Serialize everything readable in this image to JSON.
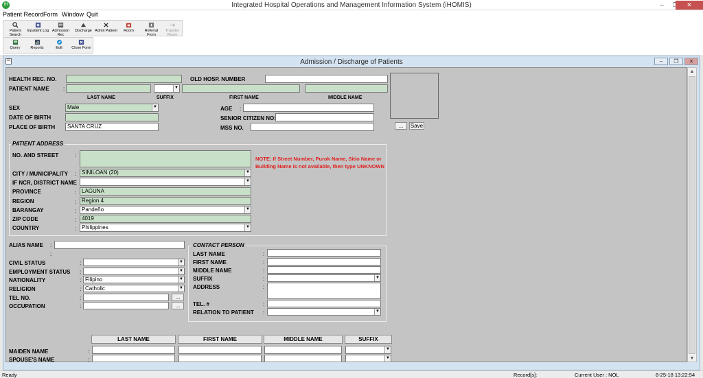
{
  "window": {
    "title": "Integrated Hospital Operations and Management Information System (iHOMIS)",
    "icon_text": "IH",
    "min": "–",
    "max": "❐",
    "close": "✕"
  },
  "menu": [
    "Patient Record",
    "Form",
    "Window",
    "Quit"
  ],
  "toolbar1": [
    {
      "label": "Patient Search",
      "icon": "patient-search-icon"
    },
    {
      "label": "Inpatient Log",
      "icon": "inpatient-log-icon"
    },
    {
      "label": "Admission Rec",
      "icon": "admission-record-icon"
    },
    {
      "label": "Discharge",
      "icon": "discharge-icon"
    },
    {
      "label": "Admit Patient",
      "icon": "admit-patient-icon"
    },
    {
      "label": "Room",
      "icon": "room-icon"
    },
    {
      "label": "Referral From",
      "icon": "referral-icon"
    },
    {
      "label": "Transfer Room",
      "icon": "transfer-room-icon"
    }
  ],
  "toolbar2": [
    {
      "label": "Query",
      "icon": "query-icon"
    },
    {
      "label": "Reports",
      "icon": "reports-icon"
    },
    {
      "label": "Edit",
      "icon": "edit-icon"
    },
    {
      "label": "Close Form",
      "icon": "close-form-icon"
    }
  ],
  "child": {
    "title": "Admission / Discharge of Patients"
  },
  "form": {
    "health_rec_no": {
      "label": "HEALTH REC. NO.",
      "value": ""
    },
    "old_hosp_number": {
      "label": "OLD HOSP. NUMBER",
      "value": ""
    },
    "patient_name": {
      "label": "PATIENT NAME",
      "colon": ":"
    },
    "name_headers": {
      "last": "LAST NAME",
      "suffix": "SUFFIX",
      "first": "FIRST NAME",
      "middle": "MIDDLE NAME"
    },
    "sex": {
      "label": "SEX",
      "value": "Male"
    },
    "date_of_birth": {
      "label": "DATE OF BIRTH",
      "value": ""
    },
    "place_of_birth": {
      "label": "PLACE OF BIRTH",
      "value": "SANTA CRUZ"
    },
    "age": {
      "label": "AGE",
      "value": ""
    },
    "senior_citizen_no": {
      "label": "SENIOR CITIZEN NO:",
      "value": ""
    },
    "mss_no": {
      "label": "MSS NO.",
      "value": ""
    },
    "photo": {
      "browse": "...",
      "save": "Save"
    },
    "address": {
      "title": "PATIENT ADDRESS",
      "no_and_street": {
        "label": "NO. AND STREET",
        "value": ""
      },
      "note": "NOTE:  If Street Number, Purok Name, Sitio Name or Building Name is not available, then type UNKNOWN",
      "city": {
        "label": "CITY / MUNICIPALITY",
        "value": "SINILOAN  (20)"
      },
      "ncr_district": {
        "label": "IF NCR, DISTRICT NAME",
        "value": ""
      },
      "province": {
        "label": "PROVINCE",
        "value": "LAGUNA"
      },
      "region": {
        "label": "REGION",
        "value": "Region 4"
      },
      "barangay": {
        "label": "BARANGAY",
        "value": "Pandeño"
      },
      "zip_code": {
        "label": "ZIP CODE",
        "value": "4019"
      },
      "country": {
        "label": "COUNTRY",
        "value": "Philippines"
      }
    },
    "alias_name": {
      "label": "ALIAS NAME",
      "value": ""
    },
    "civil_status": {
      "label": "CIVIL STATUS",
      "value": ""
    },
    "employment_status": {
      "label": "EMPLOYMENT STATUS",
      "value": ""
    },
    "nationality": {
      "label": "NATIONALITY",
      "value": "Filipino"
    },
    "religion": {
      "label": "RELIGION",
      "value": "Catholic"
    },
    "tel_no": {
      "label": "TEL NO.",
      "value": "",
      "btn": "..."
    },
    "occupation": {
      "label": "OCCUPATION",
      "value": "",
      "btn": "..."
    },
    "contact": {
      "title": "CONTACT PERSON",
      "last_name": {
        "label": "LAST NAME",
        "value": ""
      },
      "first_name": {
        "label": "FIRST NAME",
        "value": ""
      },
      "middle_name": {
        "label": "MIDDLE NAME",
        "value": ""
      },
      "suffix": {
        "label": "SUFFIX",
        "value": ""
      },
      "address": {
        "label": "ADDRESS",
        "value": ""
      },
      "tel": {
        "label": "TEL. #",
        "value": ""
      },
      "relation": {
        "label": "RELATION TO PATIENT",
        "value": ""
      }
    },
    "spouse_headers": {
      "last": "LAST NAME",
      "first": "FIRST NAME",
      "middle": "MIDDLE NAME",
      "suffix": "SUFFIX"
    },
    "maiden_name": {
      "label": "MAIDEN NAME"
    },
    "spouse_name": {
      "label": "SPOUSE'S NAME"
    }
  },
  "status": {
    "state": "Ready",
    "records": "Record[s]:",
    "current_user": "Current User : NOL",
    "datetime": "8-25-18 13:22:54"
  }
}
